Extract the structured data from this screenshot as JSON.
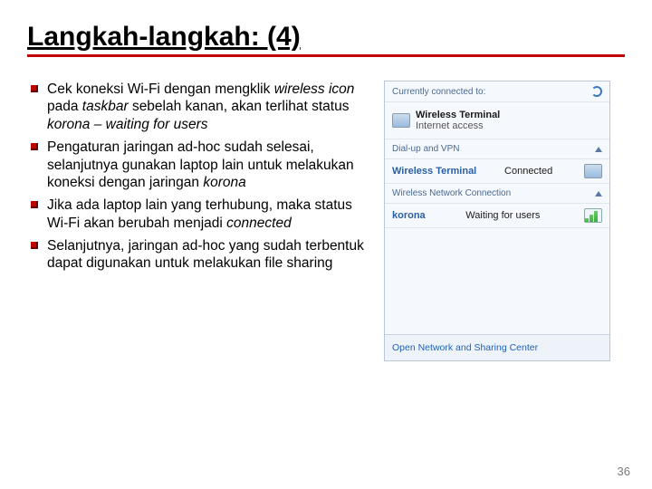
{
  "title": "Langkah-langkah: (4)",
  "bullets": [
    {
      "pre": "Cek koneksi Wi-Fi dengan mengklik ",
      "em1": "wireless icon ",
      "mid1": "pada ",
      "em2": "taskbar ",
      "mid2": "sebelah kanan, akan terlihat status ",
      "em3": "korona – waiting for users"
    },
    {
      "pre": "Pengaturan jaringan ad-hoc sudah selesai, selanjutnya gunakan laptop lain untuk melakukan koneksi dengan jaringan ",
      "em1": "korona",
      "mid1": "",
      "em2": "",
      "mid2": "",
      "em3": ""
    },
    {
      "pre": "Jika ada laptop lain yang terhubung, maka status Wi-Fi akan berubah menjadi ",
      "em1": "connected",
      "mid1": "",
      "em2": "",
      "mid2": "",
      "em3": ""
    },
    {
      "pre": "Selanjutnya, jaringan ad-hoc yang sudah terbentuk dapat digunakan untuk melakukan file sharing",
      "em1": "",
      "mid1": "",
      "em2": "",
      "mid2": "",
      "em3": ""
    }
  ],
  "panel": {
    "currently": "Currently connected to:",
    "wt_name": "Wireless Terminal",
    "wt_sub": "Internet access",
    "dialup": "Dial-up and VPN",
    "vpn_name": "Wireless Terminal",
    "vpn_status": "Connected",
    "wlan_hdr": "Wireless Network Connection",
    "net1": "korona",
    "net1_status": "Waiting for users",
    "footer": "Open Network and Sharing Center"
  },
  "page": "36"
}
